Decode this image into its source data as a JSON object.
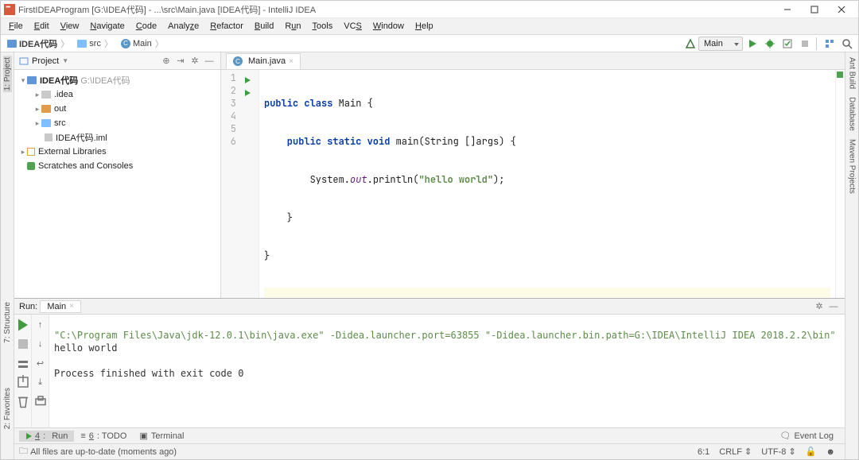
{
  "window": {
    "title": "FirstIDEAProgram [G:\\IDEA代码] - ...\\src\\Main.java [IDEA代码] - IntelliJ IDEA"
  },
  "menu": {
    "file": "File",
    "edit": "Edit",
    "view": "View",
    "navigate": "Navigate",
    "code": "Code",
    "analyze": "Analyze",
    "refactor": "Refactor",
    "build": "Build",
    "run": "Run",
    "tools": "Tools",
    "vcs": "VCS",
    "window": "Window",
    "help": "Help"
  },
  "breadcrumb": {
    "items": [
      {
        "label": "IDEA代码",
        "icon": "module"
      },
      {
        "label": "src",
        "icon": "folder"
      },
      {
        "label": "Main",
        "icon": "class"
      }
    ]
  },
  "run_config": {
    "selected": "Main"
  },
  "left_stripe": {
    "project": "1: Project",
    "structure": "7: Structure",
    "favorites": "2: Favorites"
  },
  "right_stripe": {
    "ant": "Ant Build",
    "database": "Database",
    "maven": "Maven Projects"
  },
  "sidebar": {
    "title": "Project",
    "tree": {
      "module": {
        "label": "IDEA代码",
        "hint": "G:\\IDEA代码"
      },
      "idea_dir": ".idea",
      "out_dir": "out",
      "src_dir": "src",
      "iml": "IDEA代码.iml",
      "ext_lib": "External Libraries",
      "scratches": "Scratches and Consoles"
    }
  },
  "editor": {
    "tab": "Main.java",
    "lines": [
      "1",
      "2",
      "3",
      "4",
      "5",
      "6"
    ],
    "code": {
      "l1_pre": "public class ",
      "l1_name": "Main",
      "l1_post": " {",
      "l2_pre": "    public static void ",
      "l2_name": "main",
      "l2_post": "(String []args) {",
      "l3_pre": "        System.",
      "l3_out": "out",
      "l3_mid": ".println(",
      "l3_str": "\"hello world\"",
      "l3_post": ");",
      "l4": "    }",
      "l5": "}",
      "l6": ""
    }
  },
  "run_panel": {
    "title": "Run:",
    "tab": "Main",
    "console": {
      "cmd": "\"C:\\Program Files\\Java\\jdk-12.0.1\\bin\\java.exe\" -Didea.launcher.port=63855 \"-Didea.launcher.bin.path=G:\\IDEA\\IntelliJ IDEA 2018.2.2\\bin\"",
      "out": "hello world",
      "blank": "",
      "exit": "Process finished with exit code 0"
    }
  },
  "bottom_tabs": {
    "run": "4: Run",
    "todo": "6: TODO",
    "terminal": "Terminal",
    "eventlog": "Event Log"
  },
  "status": {
    "msg": "All files are up-to-date (moments ago)",
    "pos": "6:1",
    "le": "CRLF",
    "enc": "UTF-8"
  }
}
